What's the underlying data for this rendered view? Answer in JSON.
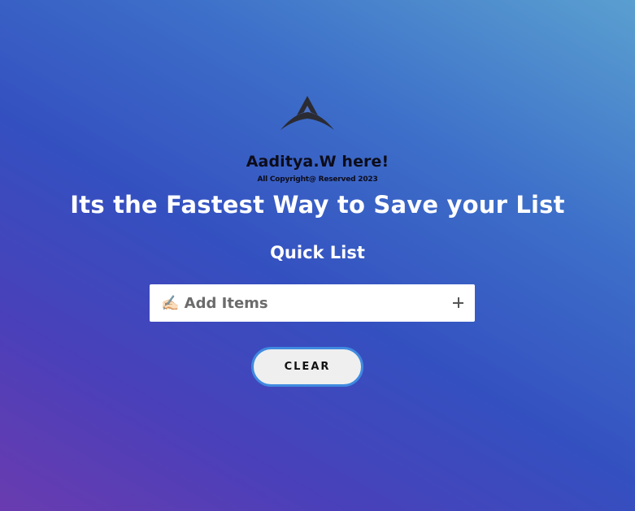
{
  "header": {
    "logo_icon": "stylized-letter-a-logo",
    "author": "Aaditya.W here!",
    "copyright": "All Copyright@ Reserved 2023"
  },
  "main": {
    "headline": "Its the Fastest Way to Save your List",
    "subtitle": "Quick List",
    "input": {
      "placeholder": "✍🏻 Add Items",
      "value": ""
    },
    "add_button_icon": "plus-icon",
    "clear_label": "CLEAR"
  },
  "colors": {
    "gradient_start": "#6a3bb0",
    "gradient_mid": "#3450c0",
    "gradient_end": "#5a9fd0",
    "clear_border": "#3f8ae0"
  }
}
